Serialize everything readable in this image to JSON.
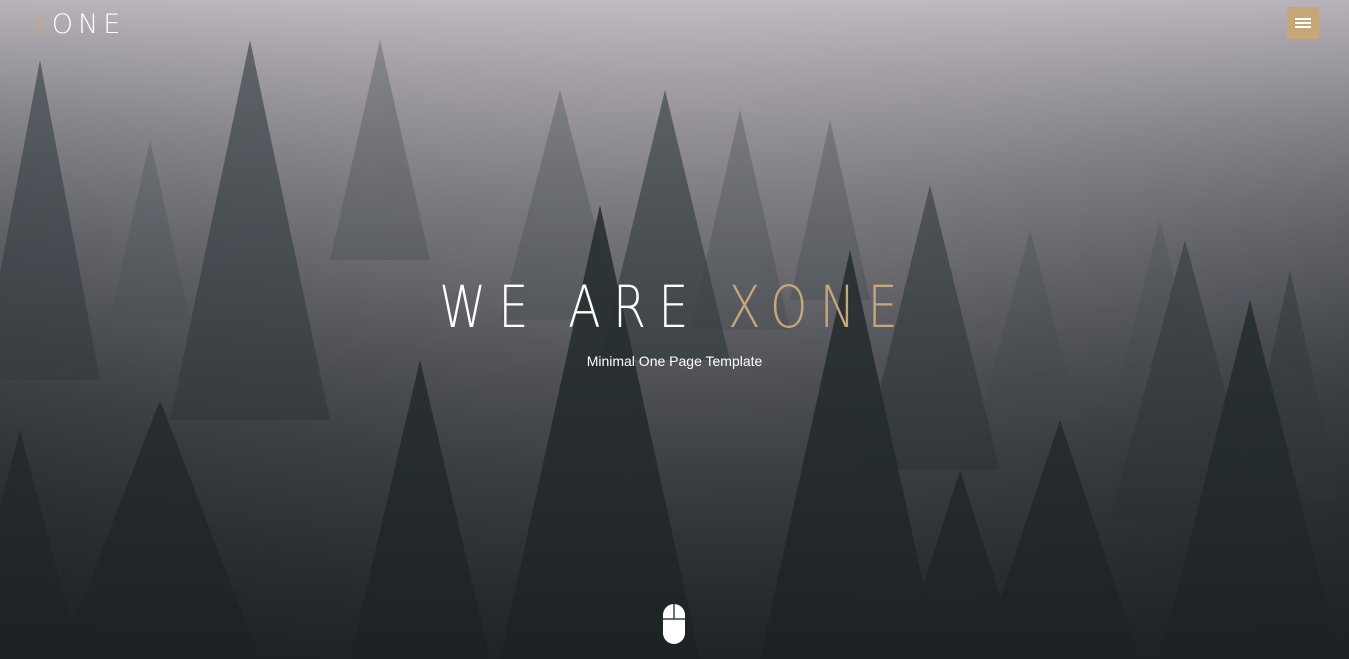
{
  "header": {
    "logo": {
      "accent_letter": "X",
      "rest": "ONE"
    },
    "menu_icon": "hamburger-menu-icon"
  },
  "hero": {
    "title_main": "WE ARE ",
    "title_accent": "XONE",
    "subtitle": "Minimal One Page Template",
    "scroll_icon": "mouse-scroll-icon",
    "background": "foggy-forest-image"
  },
  "colors": {
    "accent": "#c5a77a",
    "text": "#ffffff"
  }
}
